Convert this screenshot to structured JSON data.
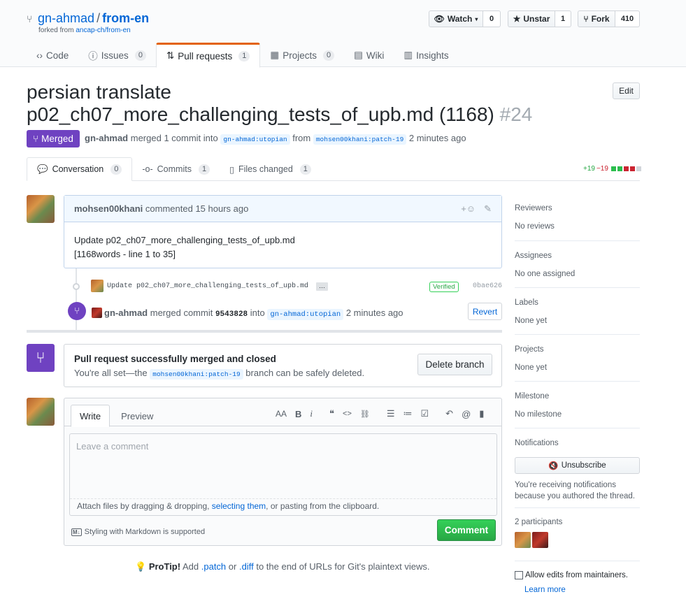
{
  "repo": {
    "owner": "gn-ahmad",
    "name": "from-en",
    "forked_from_prefix": "forked from",
    "forked_from": "ancap-ch/from-en"
  },
  "social": {
    "watch_label": "Watch",
    "watch_count": "0",
    "star_label": "Unstar",
    "star_count": "1",
    "fork_label": "Fork",
    "fork_count": "410"
  },
  "tabs": [
    {
      "label": "Code",
      "icon": "code-icon"
    },
    {
      "label": "Issues",
      "count": "0",
      "icon": "issue-icon"
    },
    {
      "label": "Pull requests",
      "count": "1",
      "icon": "pull-request-icon"
    },
    {
      "label": "Projects",
      "count": "0",
      "icon": "project-icon"
    },
    {
      "label": "Wiki",
      "icon": "book-icon"
    },
    {
      "label": "Insights",
      "icon": "graph-icon"
    }
  ],
  "pr": {
    "title_line1": "persian translate",
    "title_line2": "p02_ch07_more_challenging_tests_of_upb.md (1168)",
    "number": "#24",
    "edit_label": "Edit",
    "state": "Merged",
    "merged_by": "gn-ahmad",
    "meta_text1": "merged 1 commit into",
    "base_branch": "gn-ahmad:utopian",
    "meta_text2": "from",
    "head_branch": "mohsen00khani:patch-19",
    "meta_time": "2 minutes ago"
  },
  "subtabs": [
    {
      "label": "Conversation",
      "count": "0",
      "icon": "comment-discussion-icon"
    },
    {
      "label": "Commits",
      "count": "1",
      "icon": "commit-icon"
    },
    {
      "label": "Files changed",
      "count": "1",
      "icon": "file-diff-icon"
    }
  ],
  "diffstat": {
    "additions": "+19",
    "deletions": "−19"
  },
  "comment": {
    "author": "mohsen00khani",
    "action": "commented",
    "time": "15 hours ago",
    "body_line1": "Update p02_ch07_more_challenging_tests_of_upb.md",
    "body_line2": "[1168words - line 1 to 35]"
  },
  "commit": {
    "message": "Update p02_ch07_more_challenging_tests_of_upb.md",
    "ellipsis": "…",
    "verified": "Verified",
    "sha": "0bae626"
  },
  "merge_event": {
    "actor": "gn-ahmad",
    "action": "merged commit",
    "sha": "9543828",
    "into": "into",
    "branch": "gn-ahmad:utopian",
    "time": "2 minutes ago",
    "revert_label": "Revert"
  },
  "merged_box": {
    "title": "Pull request successfully merged and closed",
    "text1": "You're all set—the",
    "branch": "mohsen00khani:patch-19",
    "text2": "branch can be safely deleted.",
    "delete_label": "Delete branch"
  },
  "editor": {
    "write_tab": "Write",
    "preview_tab": "Preview",
    "placeholder": "Leave a comment",
    "attach_text1": "Attach files by dragging & dropping,",
    "attach_link": "selecting them",
    "attach_text2": ", or pasting from the clipboard.",
    "markdown_note": "Styling with Markdown is supported",
    "comment_button": "Comment",
    "toolbar": {
      "heading": "AA",
      "bold": "B",
      "italic": "i",
      "quote": "❝",
      "code": "<>",
      "link": "🔗"
    }
  },
  "protip": {
    "label": "ProTip!",
    "text1": "Add",
    "patch": ".patch",
    "or": "or",
    "diff": ".diff",
    "text2": "to the end of URLs for Git's plaintext views."
  },
  "sidebar": {
    "reviewers": {
      "label": "Reviewers",
      "value": "No reviews"
    },
    "assignees": {
      "label": "Assignees",
      "value": "No one assigned"
    },
    "labels": {
      "label": "Labels",
      "value": "None yet"
    },
    "projects": {
      "label": "Projects",
      "value": "None yet"
    },
    "milestone": {
      "label": "Milestone",
      "value": "No milestone"
    },
    "notifications": {
      "label": "Notifications",
      "button": "Unsubscribe",
      "reason": "You're receiving notifications because you authored the thread."
    },
    "participants": {
      "label": "2 participants"
    },
    "allow_edits": "Allow edits from maintainers.",
    "learn_more": "Learn more"
  },
  "colors": {
    "merged": "#6f42c1",
    "link": "#0366d6",
    "comment_green": "#28a745",
    "tab_accent": "#e36209"
  }
}
